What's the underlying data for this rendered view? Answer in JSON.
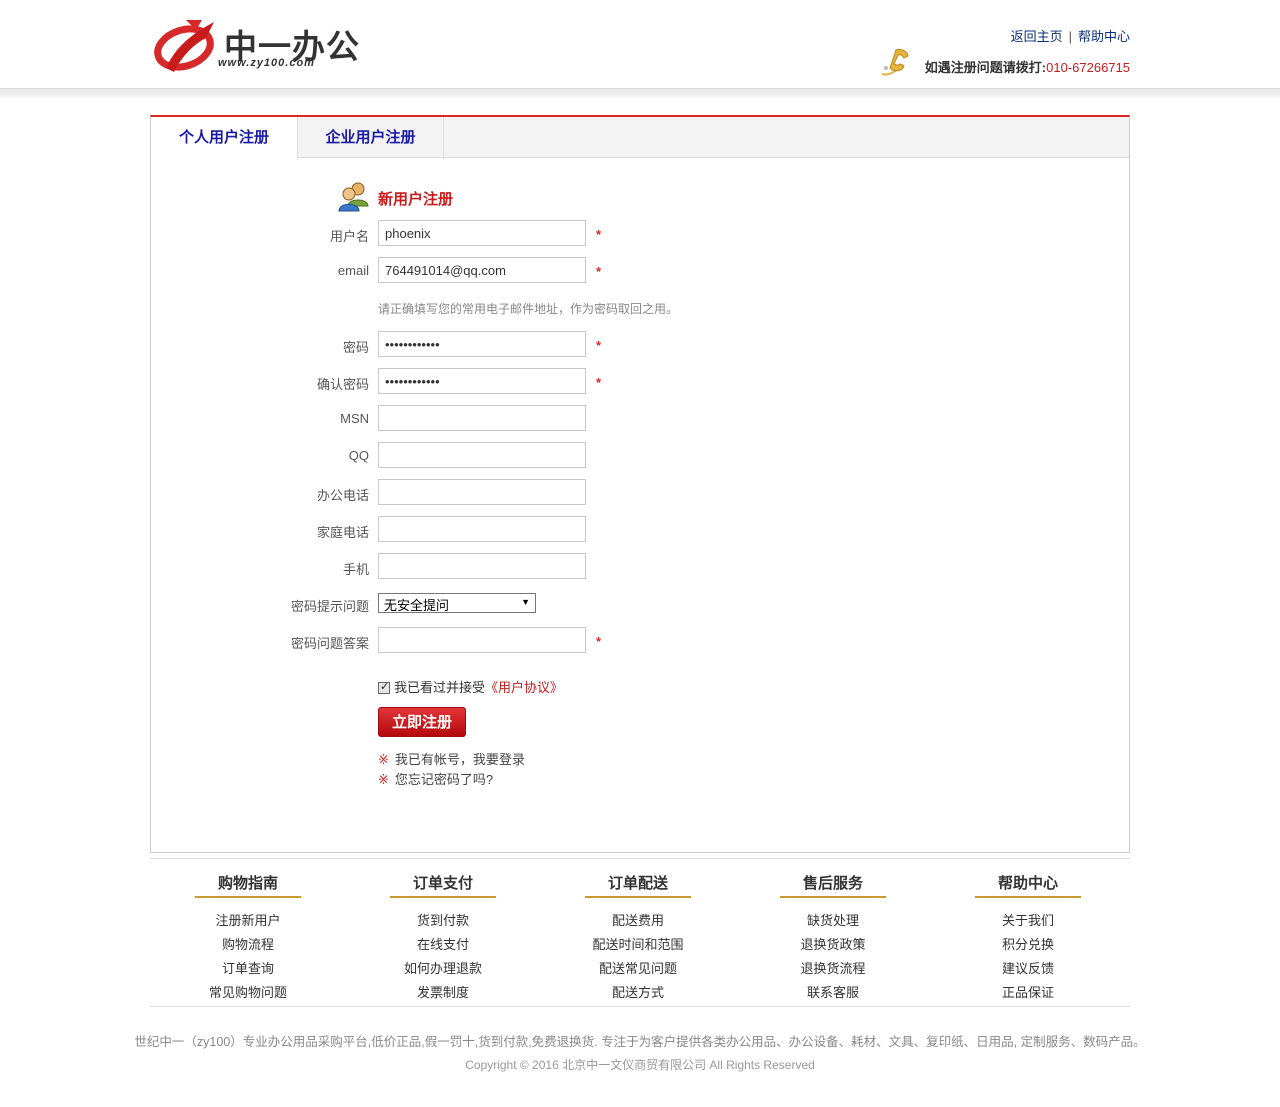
{
  "brand": {
    "name": "中一办公",
    "url": "www.zy100.com",
    "accent": "#d7282a"
  },
  "header": {
    "links": [
      "返回主页",
      "帮助中心"
    ],
    "hotline_label": "如遇注册问题请拨打:",
    "hotline_number": "010-67266715"
  },
  "tabs": [
    {
      "label": "个人用户注册",
      "active": true
    },
    {
      "label": "企业用户注册",
      "active": false
    }
  ],
  "form": {
    "title": "新用户注册",
    "fields": {
      "username": {
        "label": "用户名",
        "value": "phoenix",
        "required": true
      },
      "email": {
        "label": "email",
        "value": "764491014@qq.com",
        "required": true
      },
      "email_hint": "请正确填写您的常用电子邮件地址，作为密码取回之用。",
      "password": {
        "label": "密码",
        "value": "••••••••••••",
        "required": true
      },
      "confirm": {
        "label": "确认密码",
        "value": "••••••••••••",
        "required": true
      },
      "msn": {
        "label": "MSN",
        "value": ""
      },
      "qq": {
        "label": "QQ",
        "value": ""
      },
      "office_phone": {
        "label": "办公电话",
        "value": ""
      },
      "home_phone": {
        "label": "家庭电话",
        "value": ""
      },
      "mobile": {
        "label": "手机",
        "value": ""
      },
      "question": {
        "label": "密码提示问题",
        "value": "无安全提问"
      },
      "answer": {
        "label": "密码问题答案",
        "value": "",
        "required": true
      }
    },
    "agree_text": "我已看过并接受",
    "agree_link": "《用户协议》",
    "agree_checked": true,
    "submit_label": "立即注册",
    "tips": [
      "我已有帐号，我要登录",
      "您忘记密码了吗?"
    ],
    "required_mark": "*",
    "tip_mark": "※"
  },
  "footer": {
    "columns": [
      {
        "title": "购物指南",
        "items": [
          "注册新用户",
          "购物流程",
          "订单查询",
          "常见购物问题"
        ]
      },
      {
        "title": "订单支付",
        "items": [
          "货到付款",
          "在线支付",
          "如何办理退款",
          "发票制度"
        ]
      },
      {
        "title": "订单配送",
        "items": [
          "配送费用",
          "配送时间和范围",
          "配送常见问题",
          "配送方式"
        ]
      },
      {
        "title": "售后服务",
        "items": [
          "缺货处理",
          "退换货政策",
          "退换货流程",
          "联系客服"
        ]
      },
      {
        "title": "帮助中心",
        "items": [
          "关于我们",
          "积分兑换",
          "建议反馈",
          "正品保证"
        ]
      }
    ],
    "description": "世纪中一（zy100）专业办公用品采购平台,低价正品,假一罚十,货到付款,免费退换货. 专注于为客户提供各类办公用品、办公设备、耗材、文具、复印纸、日用品, 定制服务、数码产品。",
    "copyright": "Copyright © 2016 北京中一文仪商贸有限公司 All Rights Reserved"
  }
}
